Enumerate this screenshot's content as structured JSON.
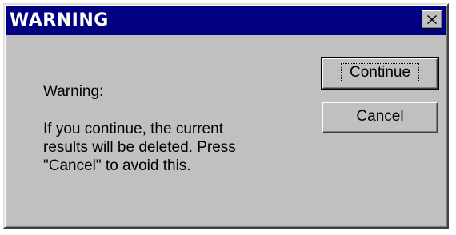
{
  "window": {
    "title": "WARNING"
  },
  "message": {
    "heading": "Warning:",
    "body": " If you continue, the current\nresults will be deleted. Press\n\"Cancel\" to avoid this."
  },
  "buttons": {
    "continue_label": "Continue",
    "cancel_label": "Cancel"
  },
  "colors": {
    "titlebar": "#000080",
    "dialog_face": "#c0c0c0",
    "title_text": "#ffffff"
  },
  "icons": {
    "close": "close-icon"
  }
}
